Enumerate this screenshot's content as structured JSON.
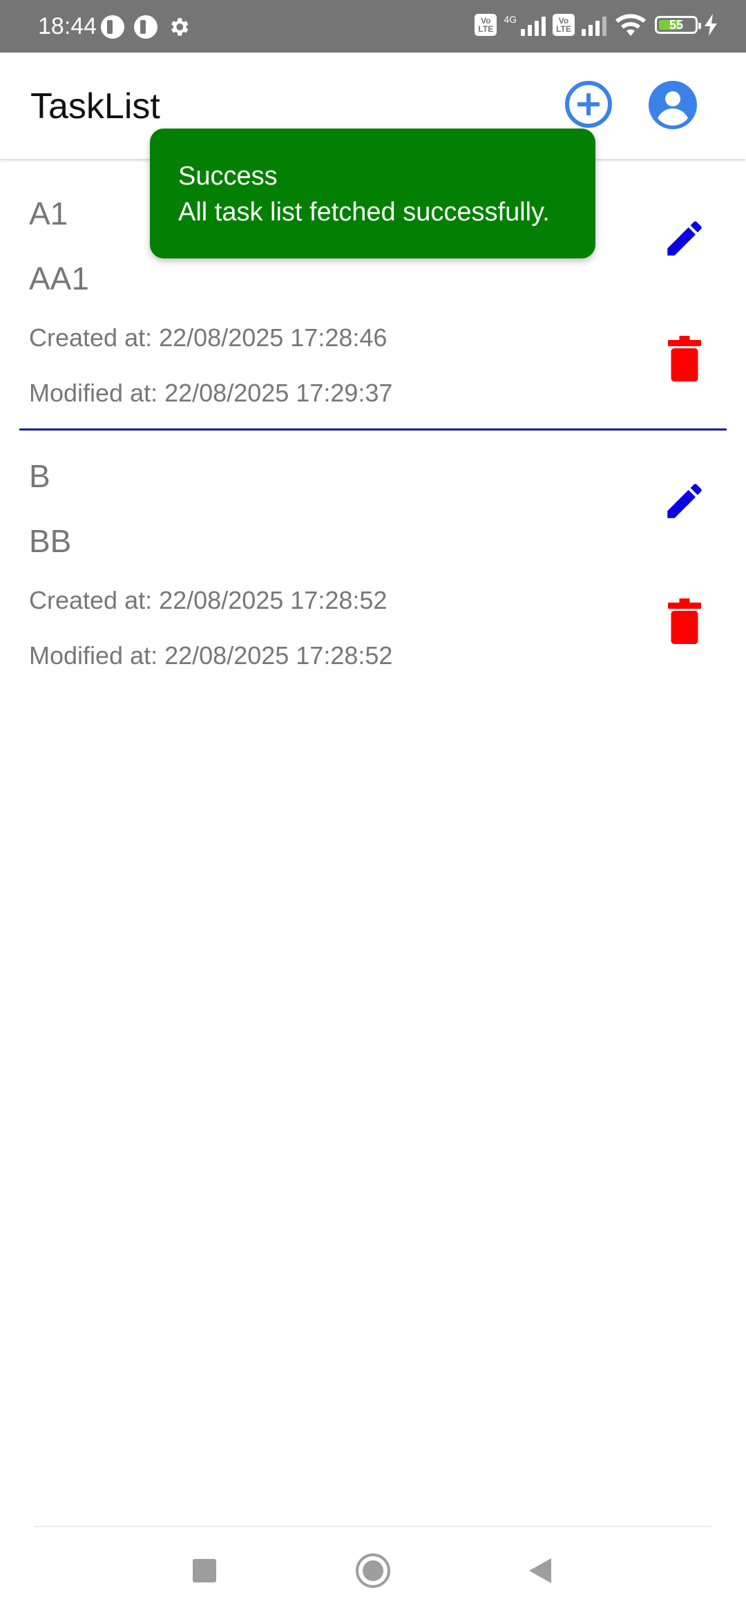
{
  "status_bar": {
    "time": "18:44",
    "network_label": "4G",
    "volte_label": "Vo LTE",
    "battery_level": "55",
    "icons": [
      "app-notification-icon",
      "app-notification-icon",
      "settings-gear-icon",
      "volte-icon",
      "signal-icon",
      "volte-icon",
      "signal-icon",
      "wifi-icon",
      "battery-icon",
      "charging-icon"
    ]
  },
  "app_bar": {
    "title": "TaskList",
    "add_icon": "add-circle-icon",
    "profile_icon": "account-circle-icon",
    "accent_color": "#3b82e8"
  },
  "toast": {
    "title": "Success",
    "message": "All task list fetched successfully.",
    "background_color": "#038003"
  },
  "tasks": [
    {
      "title": "A1",
      "description": "AA1",
      "created": "Created at: 22/08/2025 17:28:46",
      "modified": "Modified at: 22/08/2025 17:29:37"
    },
    {
      "title": "B",
      "description": "BB",
      "created": "Created at: 22/08/2025 17:28:52",
      "modified": "Modified at: 22/08/2025 17:28:52"
    }
  ],
  "colors": {
    "edit_icon": "#0a00e6",
    "delete_icon": "#ff0000",
    "divider": "#1a1aa0"
  },
  "nav_bar": {
    "icons": [
      "recents-icon",
      "home-icon",
      "back-icon"
    ]
  }
}
